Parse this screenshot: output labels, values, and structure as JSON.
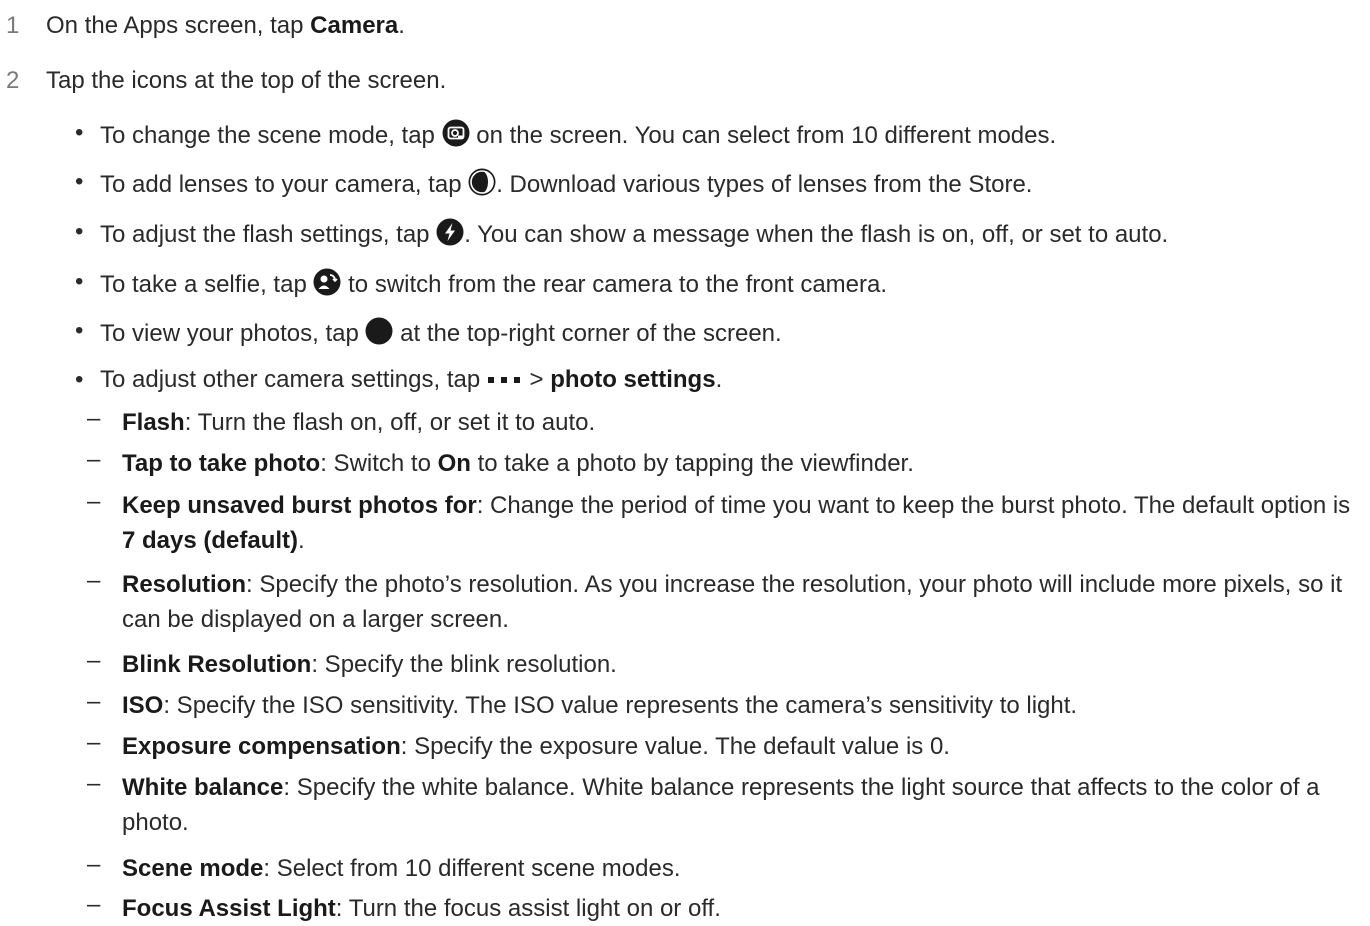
{
  "steps": [
    {
      "num": "1",
      "pre": "On the Apps screen, tap ",
      "bold": "Camera",
      "post": "."
    },
    {
      "num": "2",
      "text": "Tap the icons at the top of the screen."
    }
  ],
  "bullets": [
    {
      "pre": "To change the scene mode, tap ",
      "icon": "scene-mode-icon",
      "post": " on the screen. You can select from 10 different modes."
    },
    {
      "pre": "To add lenses to your camera, tap ",
      "icon": "lens-icon",
      "post": ". Download various types of lenses from the Store."
    },
    {
      "pre": "To adjust the flash settings, tap ",
      "icon": "flash-icon",
      "post": ". You can show a message when the flash is on, off, or set to auto."
    },
    {
      "pre": "To take a selfie, tap ",
      "icon": "switch-camera-icon",
      "post": " to switch from the rear camera to the front camera."
    },
    {
      "pre": "To view your photos, tap ",
      "icon": "photo-thumbnail-icon",
      "post": " at the top-right corner of the screen."
    },
    {
      "pre": "To adjust other camera settings, tap ",
      "icon": "more-icon",
      "mid": " > ",
      "bold": "photo settings",
      "post": "."
    }
  ],
  "settings": [
    {
      "term": "Flash",
      "desc": ": Turn the flash on, off, or set it to auto."
    },
    {
      "term": "Tap to take photo",
      "desc": ": Switch to ",
      "bold2": "On",
      "desc2": " to take a photo by tapping the viewfinder."
    },
    {
      "term": "Keep unsaved burst photos for",
      "desc": ": Change the period of time you want to keep the burst photo. The default option is ",
      "bold2": "7 days (default)",
      "desc2": "."
    },
    {
      "term": "Resolution",
      "desc": ": Specify the photo’s resolution. As you increase the resolution, your photo will include more pixels, so it can be displayed on a larger screen."
    },
    {
      "term": "Blink Resolution",
      "desc": ": Specify the blink resolution."
    },
    {
      "term": "ISO",
      "desc": ": Specify the ISO sensitivity. The ISO value represents the camera’s sensitivity to light."
    },
    {
      "term": "Exposure compensation",
      "desc": ": Specify the exposure value. The default value is 0."
    },
    {
      "term": "White balance",
      "desc": ": Specify the white balance. White balance represents the light source that affects to the color of a photo."
    },
    {
      "term": "Scene mode",
      "desc": ": Select from 10 different scene modes."
    },
    {
      "term": "Focus Assist Light",
      "desc": ": Turn the focus assist light on or off."
    }
  ],
  "bullet_char": "•",
  "dash_char": "–"
}
